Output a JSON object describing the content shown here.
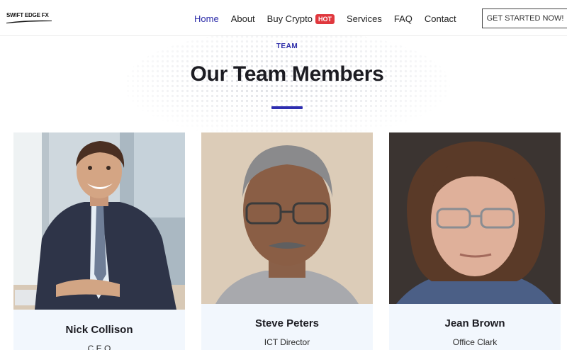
{
  "brand": {
    "name": "SWIFT EDGE FX"
  },
  "nav": {
    "items": [
      {
        "label": "Home"
      },
      {
        "label": "About"
      },
      {
        "label": "Buy Crypto"
      },
      {
        "label": "Services"
      },
      {
        "label": "FAQ"
      },
      {
        "label": "Contact"
      }
    ],
    "hot_badge": "HOT",
    "cta_label": "GET STARTED NOW!"
  },
  "section": {
    "eyebrow": "TEAM",
    "title": "Our Team Members"
  },
  "team": [
    {
      "name": "Nick Collison",
      "role": "C.E.O"
    },
    {
      "name": "Steve Peters",
      "role": "ICT Director"
    },
    {
      "name": "Jean Brown",
      "role": "Office Clark"
    }
  ],
  "colors": {
    "accent": "#2a2aa8",
    "hot_badge": "#e0383e",
    "card_info_bg": "#f2f7fd"
  }
}
